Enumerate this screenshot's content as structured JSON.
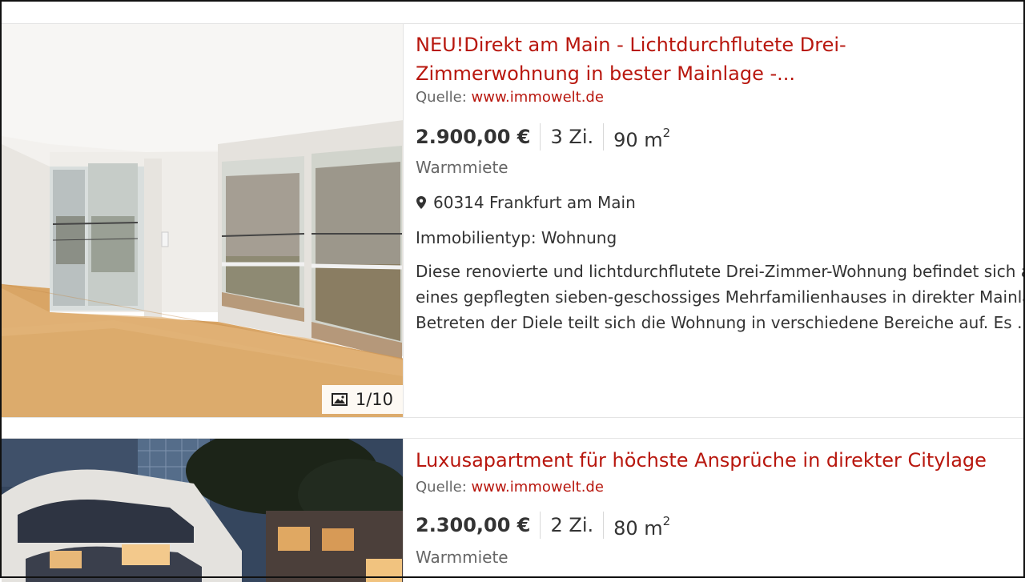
{
  "listings": [
    {
      "title": "NEU!Direkt am Main - Lichtdurchflutete Drei-Zimmerwohnung in bester Mainlage -...",
      "source_label": "Quelle:",
      "source_link": "www.immowelt.de",
      "price": "2.900,00 €",
      "rooms": "3 Zi.",
      "area": "90 m",
      "area_sup": "2",
      "rent_type": "Warmmiete",
      "location": "60314 Frankfurt am Main",
      "property_type": "Immobilientyp: Wohnung",
      "description_lines": [
        "Diese renovierte und lichtdurchflutete Drei-Zimmer-Wohnung befindet sich au",
        "eines gepflegten sieben-geschossiges Mehrfamilienhauses in direkter Mainlage",
        "Betreten der Diele teilt sich die Wohnung in verschiedene Bereiche auf. Es ..."
      ],
      "more_link": "[",
      "image_counter": "1/10",
      "image_icon": "picture-icon"
    },
    {
      "title": "Luxusapartment für höchste Ansprüche in direkter Citylage",
      "source_label": "Quelle:",
      "source_link": "www.immowelt.de",
      "price": "2.300,00 €",
      "rooms": "2 Zi.",
      "area": "80 m",
      "area_sup": "2",
      "rent_type": "Warmmiete"
    }
  ],
  "icons": {
    "location": "map-pin-icon",
    "image": "picture-icon"
  },
  "colors": {
    "accent": "#b8170e",
    "text": "#333333",
    "muted": "#666666"
  }
}
